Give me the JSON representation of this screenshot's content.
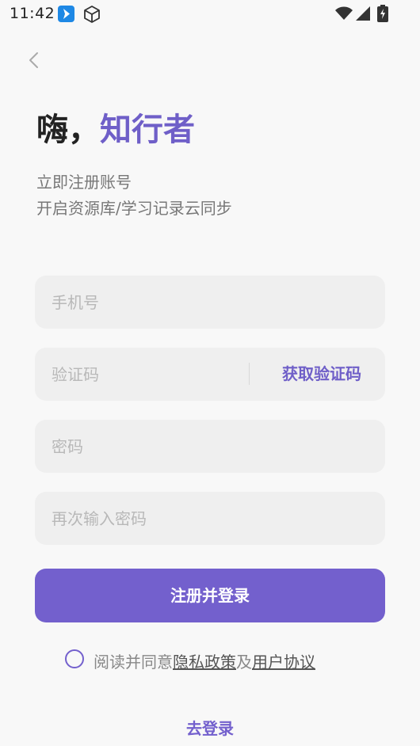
{
  "status_bar": {
    "time": "11:42",
    "icons": [
      "app-notification-icon",
      "cube-icon",
      "wifi-icon",
      "cell-signal-icon",
      "battery-charging-icon"
    ]
  },
  "header": {
    "back_icon": "chevron-left-icon"
  },
  "greeting": {
    "prefix": "嗨，",
    "highlight": "知行者"
  },
  "subtitle": {
    "line1": "立即注册账号",
    "line2": "开启资源库/学习记录云同步"
  },
  "form": {
    "phone_placeholder": "手机号",
    "code_placeholder": "验证码",
    "get_code_label": "获取验证码",
    "password_placeholder": "密码",
    "confirm_password_placeholder": "再次输入密码",
    "submit_label": "注册并登录"
  },
  "agreement": {
    "prefix": "阅读并同意",
    "privacy_link": "隐私政策",
    "conjunction": "及",
    "terms_link": "用户协议"
  },
  "footer": {
    "login_label": "去登录"
  },
  "colors": {
    "accent": "#7360cd",
    "background": "#f8f8f8",
    "field_bg": "#efefef"
  }
}
